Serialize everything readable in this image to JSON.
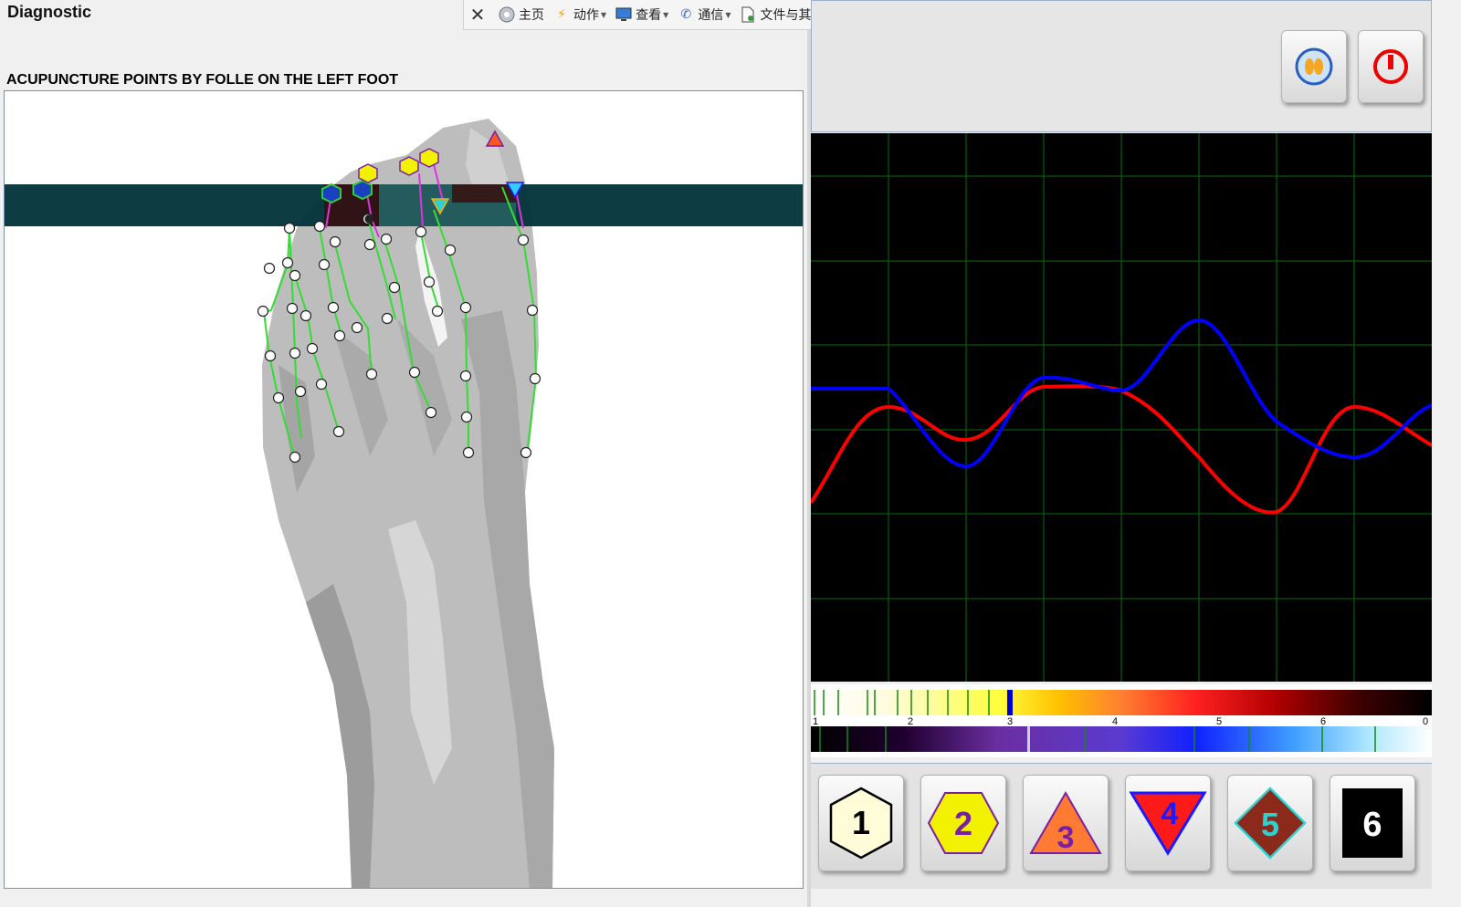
{
  "app": {
    "title": "Diagnostic"
  },
  "panel": {
    "heading": "ACUPUNCTURE POINTS BY FOLLE ON THE LEFT FOOT"
  },
  "toolbar": {
    "items": [
      {
        "label": "",
        "icon": "close-icon"
      },
      {
        "label": "主页",
        "icon": "home-icon"
      },
      {
        "label": "动作",
        "icon": "lightning-icon"
      },
      {
        "label": "查看",
        "icon": "monitor-icon"
      },
      {
        "label": "通信",
        "icon": "phone-icon"
      },
      {
        "label": "文件与其他",
        "icon": "file-icon"
      },
      {
        "label": "",
        "icon": "chat-icon"
      },
      {
        "label": "",
        "icon": "smiley-icon"
      }
    ]
  },
  "scale": {
    "ticks": [
      "1",
      "2",
      "3",
      "4",
      "5",
      "6",
      "0"
    ]
  },
  "symbols": [
    {
      "label": "1",
      "shape": "hexagon",
      "fill": "#fffdd8",
      "text": "#000000"
    },
    {
      "label": "2",
      "shape": "hexagon-flat",
      "fill": "#f2f200",
      "text": "#7a1fa2"
    },
    {
      "label": "3",
      "shape": "triangle-up",
      "fill": "#ff7a33",
      "text": "#7a1fa2"
    },
    {
      "label": "4",
      "shape": "triangle-down",
      "fill": "#ff1a1a",
      "text": "#1a1aff"
    },
    {
      "label": "5",
      "shape": "diamond",
      "fill": "#8b2a1a",
      "text": "#2fd0d0"
    },
    {
      "label": "6",
      "shape": "square",
      "fill": "#000000",
      "text": "#ffffff"
    }
  ],
  "colors": {
    "graph_red": "#ff0000",
    "graph_blue": "#0000ff",
    "grid": "#0a6b0a"
  }
}
